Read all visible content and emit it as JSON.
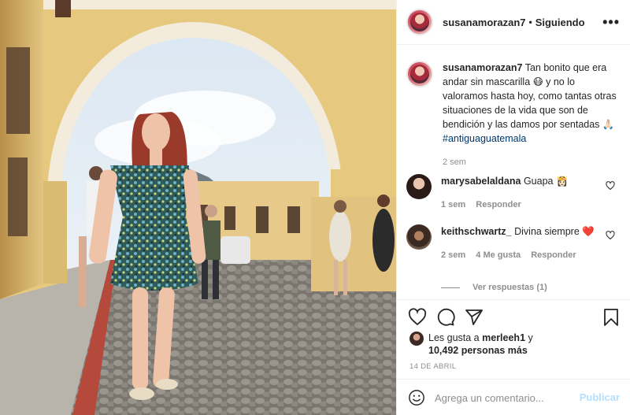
{
  "header": {
    "username": "susanamorazan7",
    "separator": "•",
    "follow_status": "Siguiendo",
    "more_label": "•••"
  },
  "caption": {
    "username": "susanamorazan7",
    "text": "Tan bonito que era andar sin mascarilla 😷 y no lo valoramos hasta hoy, como tantas otras situaciones de la vida que son de bendición y las damos por sentadas 🙏🏻",
    "hashtag": "#antiguaguatemala",
    "time": "2 sem"
  },
  "comments": [
    {
      "username": "marysabelaldana",
      "text": "Guapa 👸🏻",
      "time": "1 sem",
      "likes": "",
      "reply": "Responder"
    },
    {
      "username": "keithschwartz_",
      "text": "Divina siempre ❤️",
      "time": "2 sem",
      "likes": "4 Me gusta",
      "reply": "Responder"
    }
  ],
  "view_replies": "Ver respuestas (1)",
  "likes": {
    "prefix": "Les gusta a",
    "user": "merleeh1",
    "connector": "y",
    "others": "10,492 personas más"
  },
  "date": "14 DE ABRIL",
  "add_comment": {
    "placeholder": "Agrega un comentario...",
    "publish": "Publicar"
  },
  "icons": [
    "heart-icon",
    "comment-icon",
    "share-icon",
    "bookmark-icon",
    "emoji-icon",
    "more-icon"
  ],
  "colors": {
    "link": "#00376b",
    "muted": "#8e8e8e",
    "publish_disabled": "#b2dffc",
    "border": "#efefef"
  }
}
